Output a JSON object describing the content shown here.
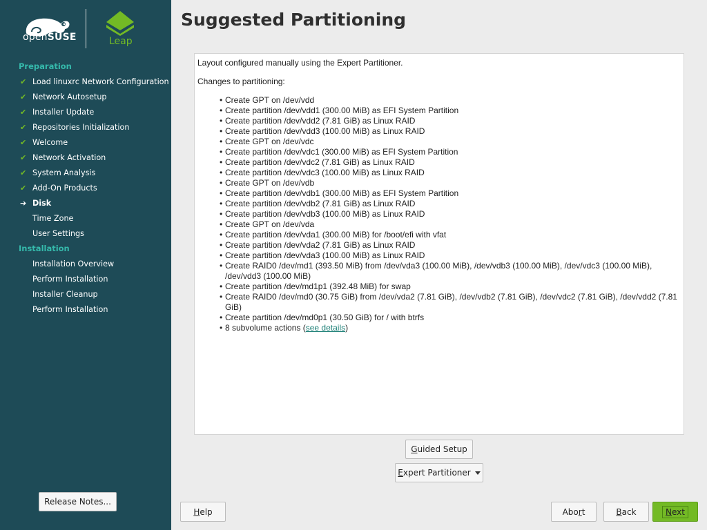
{
  "sidebar": {
    "brand": {
      "opensuse_prefix": "open",
      "opensuse_suffix": "SUSE",
      "leap": "Leap"
    },
    "sections": [
      {
        "label": "Preparation"
      },
      {
        "label": "Installation"
      }
    ],
    "steps": [
      {
        "label": "Load linuxrc Network Configuration",
        "status": "done"
      },
      {
        "label": "Network Autosetup",
        "status": "done"
      },
      {
        "label": "Installer Update",
        "status": "done"
      },
      {
        "label": "Repositories Initialization",
        "status": "done"
      },
      {
        "label": "Welcome",
        "status": "done"
      },
      {
        "label": "Network Activation",
        "status": "done"
      },
      {
        "label": "System Analysis",
        "status": "done"
      },
      {
        "label": "Add-On Products",
        "status": "done"
      },
      {
        "label": "Disk",
        "status": "current"
      },
      {
        "label": "Time Zone",
        "status": "todo"
      },
      {
        "label": "User Settings",
        "status": "todo"
      },
      {
        "label": "Installation Overview",
        "status": "todo"
      },
      {
        "label": "Perform Installation",
        "status": "todo"
      },
      {
        "label": "Installer Cleanup",
        "status": "todo"
      },
      {
        "label": "Perform Installation",
        "status": "todo"
      }
    ],
    "check_glyph": "✔",
    "arrow_glyph": "➔",
    "release_notes_label": "Release Notes..."
  },
  "main": {
    "title": "Suggested Partitioning",
    "intro": "Layout configured manually using the Expert Partitioner.",
    "changes_heading": "Changes to partitioning:",
    "changes": [
      "Create GPT on /dev/vdd",
      "Create partition /dev/vdd1 (300.00 MiB) as EFI System Partition",
      "Create partition /dev/vdd2 (7.81 GiB) as Linux RAID",
      "Create partition /dev/vdd3 (100.00 MiB) as Linux RAID",
      "Create GPT on /dev/vdc",
      "Create partition /dev/vdc1 (300.00 MiB) as EFI System Partition",
      "Create partition /dev/vdc2 (7.81 GiB) as Linux RAID",
      "Create partition /dev/vdc3 (100.00 MiB) as Linux RAID",
      "Create GPT on /dev/vdb",
      "Create partition /dev/vdb1 (300.00 MiB) as EFI System Partition",
      "Create partition /dev/vdb2 (7.81 GiB) as Linux RAID",
      "Create partition /dev/vdb3 (100.00 MiB) as Linux RAID",
      "Create GPT on /dev/vda",
      "Create partition /dev/vda1 (300.00 MiB) for /boot/efi with vfat",
      "Create partition /dev/vda2 (7.81 GiB) as Linux RAID",
      "Create partition /dev/vda3 (100.00 MiB) as Linux RAID",
      "Create RAID0 /dev/md1 (393.50 MiB) from /dev/vda3 (100.00 MiB), /dev/vdb3 (100.00 MiB), /dev/vdc3 (100.00 MiB), /dev/vdd3 (100.00 MiB)",
      "Create partition /dev/md1p1 (392.48 MiB) for swap",
      "Create RAID0 /dev/md0 (30.75 GiB) from /dev/vda2 (7.81 GiB), /dev/vdb2 (7.81 GiB), /dev/vdc2 (7.81 GiB), /dev/vdd2 (7.81 GiB)",
      "Create partition /dev/md0p1 (30.50 GiB) for / with btrfs"
    ],
    "subvolume_prefix": "8 subvolume actions (",
    "subvolume_link": "see details",
    "subvolume_suffix": ")",
    "guided_setup_key": "G",
    "guided_setup_rest": "uided Setup",
    "expert_partitioner_key": "E",
    "expert_partitioner_rest": "xpert Partitioner"
  },
  "footer": {
    "help_key": "H",
    "help_rest": "elp",
    "abort_pre": "Abo",
    "abort_key": "r",
    "abort_post": "t",
    "back_key": "B",
    "back_rest": "ack",
    "next_key": "N",
    "next_rest": "ext"
  },
  "colors": {
    "sidebar_bg": "#1e4b57",
    "accent_teal": "#35b9ab",
    "accent_green": "#73ba25"
  }
}
